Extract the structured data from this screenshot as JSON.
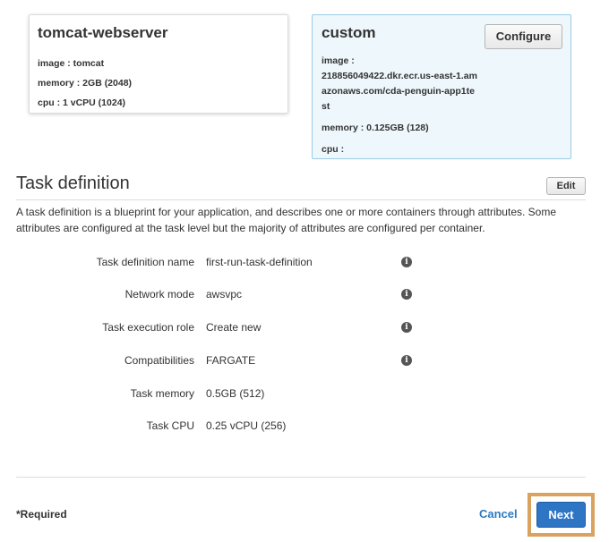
{
  "containers": [
    {
      "title": "tomcat-webserver",
      "image": "image : tomcat",
      "memory": "memory :  2GB (2048)",
      "cpu": "cpu :  1 vCPU (1024)"
    },
    {
      "title": "custom",
      "configure_label": "Configure",
      "image_label": "image :",
      "image_value": "218856049422.dkr.ecr.us-east-1.amazonaws.com/cda-penguin-app1test",
      "memory": "memory :  0.125GB (128)",
      "cpu": "cpu :"
    }
  ],
  "task_definition": {
    "title": "Task definition",
    "edit_label": "Edit",
    "description": "A task definition is a blueprint for your application, and describes one or more containers through attributes. Some attributes are configured at the task level but the majority of attributes are configured per container.",
    "rows": [
      {
        "label": "Task definition name",
        "value": "first-run-task-definition",
        "info": "i"
      },
      {
        "label": "Network mode",
        "value": "awsvpc",
        "info": "i"
      },
      {
        "label": "Task execution role",
        "value": "Create new",
        "info": "i"
      },
      {
        "label": "Compatibilities",
        "value": "FARGATE",
        "info": "i"
      },
      {
        "label": "Task memory",
        "value": "0.5GB (512)"
      },
      {
        "label": "Task CPU",
        "value": "0.25 vCPU (256)"
      }
    ]
  },
  "footer": {
    "required": "*Required",
    "cancel": "Cancel",
    "next": "Next"
  },
  "colors": {
    "primary_button": "#2e75c4",
    "link": "#2d7bc0",
    "highlight_border": "#d9a35f",
    "selected_card_bg": "#eef7fc"
  }
}
